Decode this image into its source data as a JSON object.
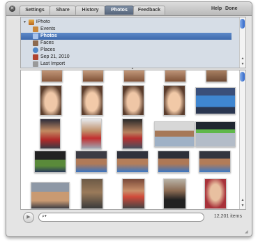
{
  "tabs": [
    {
      "label": "Settings",
      "active": false
    },
    {
      "label": "Share",
      "active": false
    },
    {
      "label": "History",
      "active": false
    },
    {
      "label": "Photos",
      "active": true
    },
    {
      "label": "Feedback",
      "active": false
    }
  ],
  "header": {
    "help_label": "Help",
    "done_label": "Done",
    "close_icon": "close-icon"
  },
  "source_list": {
    "root": {
      "label": "iPhoto",
      "icon": "iphoto-icon",
      "expanded": true
    },
    "items": [
      {
        "label": "Events",
        "icon": "events-icon",
        "selected": false,
        "color": "#c9873a"
      },
      {
        "label": "Photos",
        "icon": "photos-icon",
        "selected": true,
        "color": "#7c9fd4"
      },
      {
        "label": "Faces",
        "icon": "faces-icon",
        "selected": false,
        "color": "#8d6a4f"
      },
      {
        "label": "Places",
        "icon": "places-icon",
        "selected": false,
        "color": "#4f86c6"
      },
      {
        "label": "Sep 21, 2010",
        "icon": "event-thumbnail-icon",
        "selected": false,
        "color": "#b0432e"
      },
      {
        "label": "Last Import",
        "icon": "last-import-icon",
        "selected": false,
        "color": "#9a9a9a"
      }
    ]
  },
  "photo_browser": {
    "rows": [
      {
        "photos": [
          {
            "subject": "child"
          },
          {
            "subject": "child"
          },
          {
            "subject": "child"
          },
          {
            "subject": "child"
          },
          {
            "subject": "child"
          }
        ]
      },
      {
        "photos": [
          {
            "subject": "baby"
          },
          {
            "subject": "baby"
          },
          {
            "subject": "baby"
          },
          {
            "subject": "baby"
          },
          {
            "subject": "boxing-ring"
          }
        ]
      },
      {
        "photos": [
          {
            "subject": "boxer"
          },
          {
            "subject": "boxer"
          },
          {
            "subject": "boxer"
          },
          {
            "subject": "boxing-ring"
          },
          {
            "subject": "boxing-ring"
          }
        ]
      },
      {
        "photos": [
          {
            "subject": "boxing-ring"
          },
          {
            "subject": "boxing-ring"
          },
          {
            "subject": "boxing-ring"
          },
          {
            "subject": "boxing-ring"
          },
          {
            "subject": "boxing-ring"
          }
        ]
      },
      {
        "photos": [
          {
            "subject": "people"
          },
          {
            "subject": "people"
          },
          {
            "subject": "people"
          },
          {
            "subject": "people"
          },
          {
            "subject": "people"
          }
        ]
      }
    ]
  },
  "status_bar": {
    "play_icon": "play-icon",
    "search_icon": "search-icon",
    "search_value": "",
    "item_count": "12,201 items"
  },
  "colors": {
    "accent": "#3d69ac",
    "tab_active": "#55647a",
    "source_bg": "#d6dde6"
  }
}
